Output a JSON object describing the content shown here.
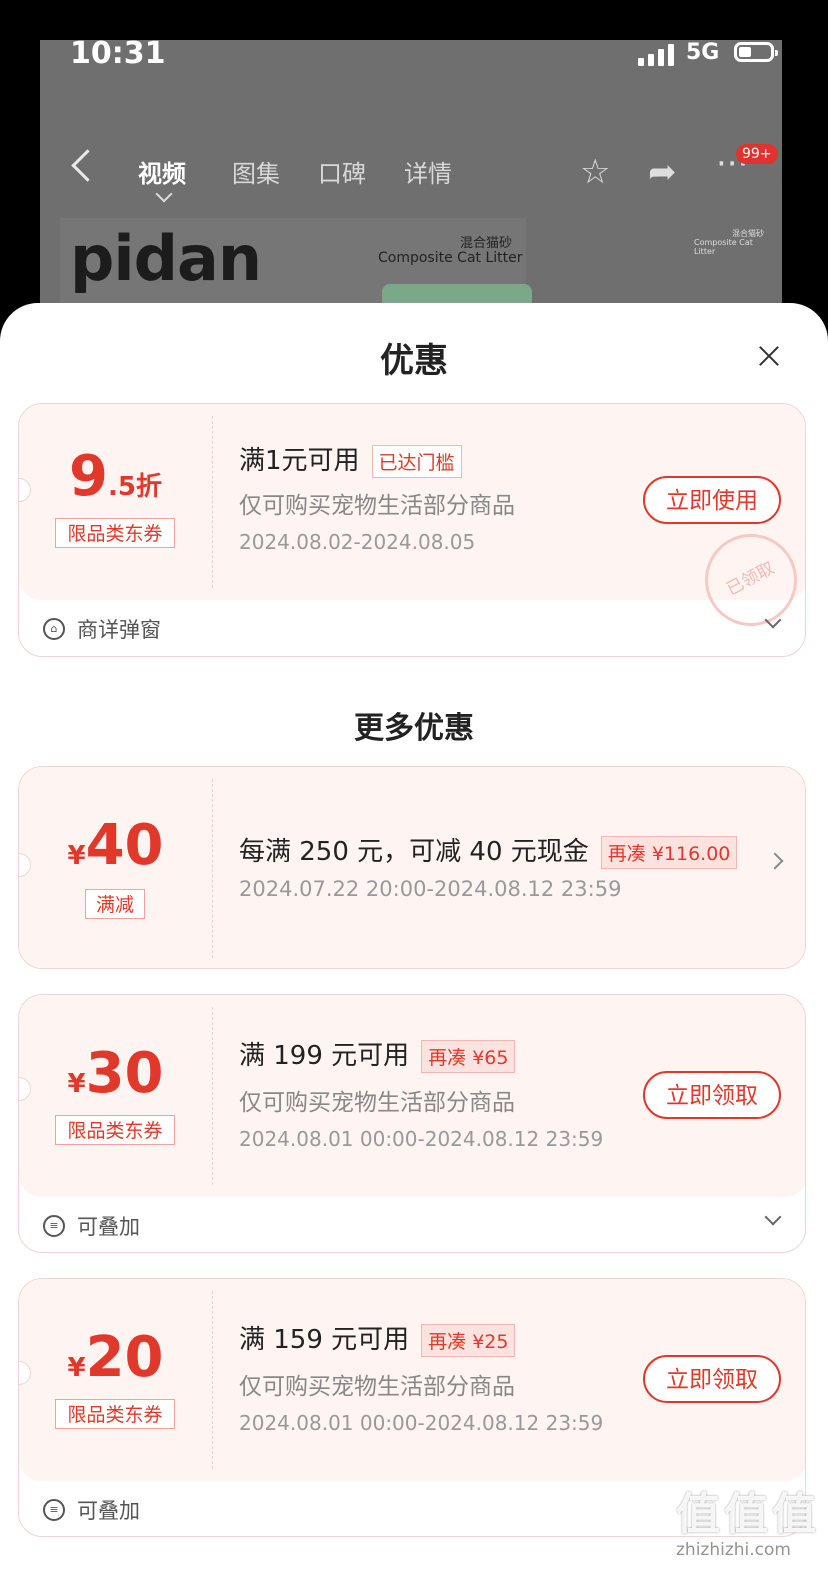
{
  "status": {
    "time": "10:31",
    "network": "5G"
  },
  "nav": {
    "tabs": [
      {
        "label": "视频"
      },
      {
        "label": "图集"
      },
      {
        "label": "口碑"
      },
      {
        "label": "详情"
      }
    ],
    "badge": "99+"
  },
  "hero": {
    "brand": "pidan",
    "product_cn": "混合猫砂",
    "product_en": "Composite Cat Litter"
  },
  "sheet": {
    "title": "优惠",
    "section_more": "更多优惠"
  },
  "coupons": [
    {
      "amount_big": "9",
      "amount_small": ".5折",
      "tag": "限品类东券",
      "line1": "满1元可用",
      "chip": "已达门槛",
      "line2": "仅可购买宠物生活部分商品",
      "line3": "2024.08.02-2024.08.05",
      "button": "立即使用",
      "stamp": "已领取",
      "footer": "商详弹窗"
    },
    {
      "yen": "¥",
      "amount_big": "40",
      "tag": "满减",
      "line1": "每满 250 元，可减 40 元现金",
      "chip": "再凑 ¥116.00",
      "line3": "2024.07.22 20:00-2024.08.12 23:59"
    },
    {
      "yen": "¥",
      "amount_big": "30",
      "tag": "限品类东券",
      "line1": "满 199 元可用",
      "chip": "再凑 ¥65",
      "line2": "仅可购买宠物生活部分商品",
      "line3": "2024.08.01 00:00-2024.08.12 23:59",
      "button": "立即领取",
      "footer": "可叠加"
    },
    {
      "yen": "¥",
      "amount_big": "20",
      "tag": "限品类东券",
      "line1": "满 159 元可用",
      "chip": "再凑 ¥25",
      "line2": "仅可购买宠物生活部分商品",
      "line3": "2024.08.01 00:00-2024.08.12 23:59",
      "button": "立即领取",
      "footer": "可叠加"
    }
  ],
  "watermark": {
    "logo": "值值值",
    "site": "zhizhizhi.com"
  },
  "colors": {
    "accent": "#e0392b",
    "coupon_bg": "#fef4f2"
  }
}
